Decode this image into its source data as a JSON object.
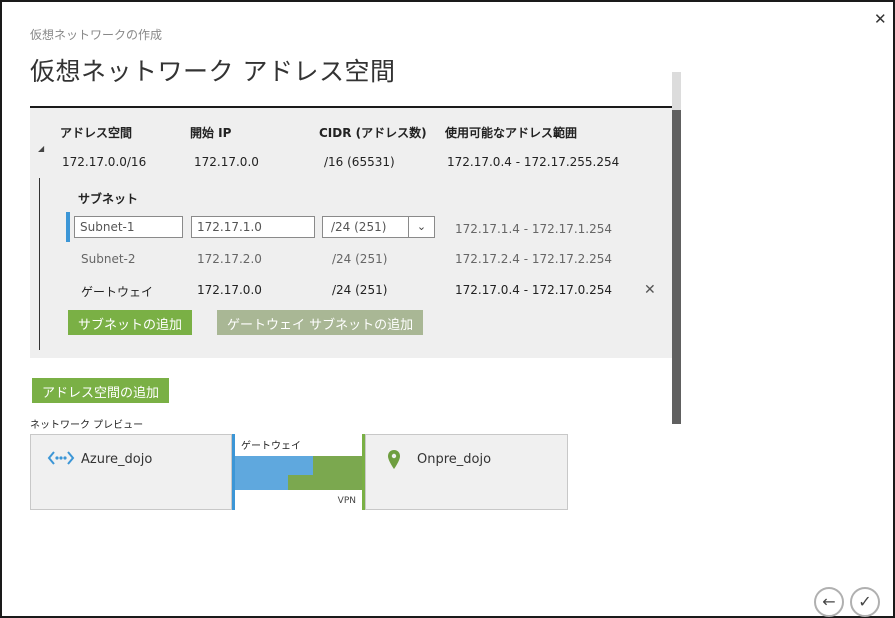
{
  "dialog": {
    "subtitle": "仮想ネットワークの作成",
    "title": "仮想ネットワーク アドレス空間",
    "close_glyph": "✕"
  },
  "address_space": {
    "headers": [
      "アドレス空間",
      "開始 IP",
      "CIDR (アドレス数)",
      "使用可能なアドレス範囲"
    ],
    "row": {
      "address_space": "172.17.0.0/16",
      "start_ip": "172.17.0.0",
      "cidr": "/16 (65531)",
      "range": "172.17.0.4 - 172.17.255.254"
    }
  },
  "subnets": {
    "heading": "サブネット",
    "editing": {
      "name_value": "Subnet-1",
      "start_ip_value": "172.17.1.0",
      "cidr_value": "/24 (251)",
      "range": "172.17.1.4 - 172.17.1.254"
    },
    "rows": [
      {
        "name": "Subnet-2",
        "start_ip": "172.17.2.0",
        "cidr": "/24 (251)",
        "range": "172.17.2.4 - 172.17.2.254"
      },
      {
        "name": "ゲートウェイ",
        "start_ip": "172.17.0.0",
        "cidr": "/24 (251)",
        "range": "172.17.0.4 - 172.17.0.254"
      }
    ],
    "delete_glyph": "✕",
    "add_subnet_label": "サブネットの追加",
    "add_gateway_subnet_label": "ゲートウェイ サブネットの追加"
  },
  "add_address_space_label": "アドレス空間の追加",
  "preview": {
    "label": "ネットワーク プレビュー",
    "azure_name": "Azure_dojo",
    "gateway_label": "ゲートウェイ",
    "vpn_label": "VPN",
    "onprem_name": "Onpre_dojo"
  },
  "nav": {
    "back_glyph": "←",
    "done_glyph": "✓"
  },
  "colors": {
    "accent_green": "#7ab045",
    "accent_blue": "#3c96d6",
    "disabled_green": "#a9b795"
  }
}
